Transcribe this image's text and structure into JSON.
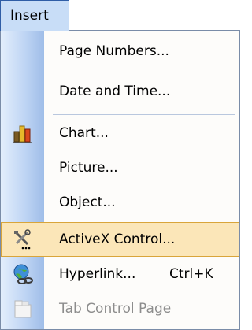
{
  "menu": {
    "title": "Insert",
    "items": [
      {
        "label": "Page Numbers...",
        "icon": null,
        "state": "normal"
      },
      {
        "label": "Date and Time...",
        "icon": null,
        "state": "normal"
      },
      {
        "label": "Chart...",
        "icon": "chart-icon",
        "state": "normal"
      },
      {
        "label": "Picture...",
        "icon": null,
        "state": "normal"
      },
      {
        "label": "Object...",
        "icon": null,
        "state": "normal"
      },
      {
        "label": "ActiveX Control...",
        "icon": "tools-icon",
        "state": "highlighted"
      },
      {
        "label": "Hyperlink...",
        "shortcut": "Ctrl+K",
        "icon": "hyperlink-icon",
        "state": "normal"
      },
      {
        "label": "Tab Control Page",
        "icon": "tab-page-icon",
        "state": "disabled"
      }
    ]
  },
  "colors": {
    "title_bg": "#c8ddf7",
    "title_border": "#2f5da6",
    "highlight_bg": "#fbe6b8",
    "highlight_border": "#d9a53a",
    "disabled_text": "#8d8d8d"
  }
}
